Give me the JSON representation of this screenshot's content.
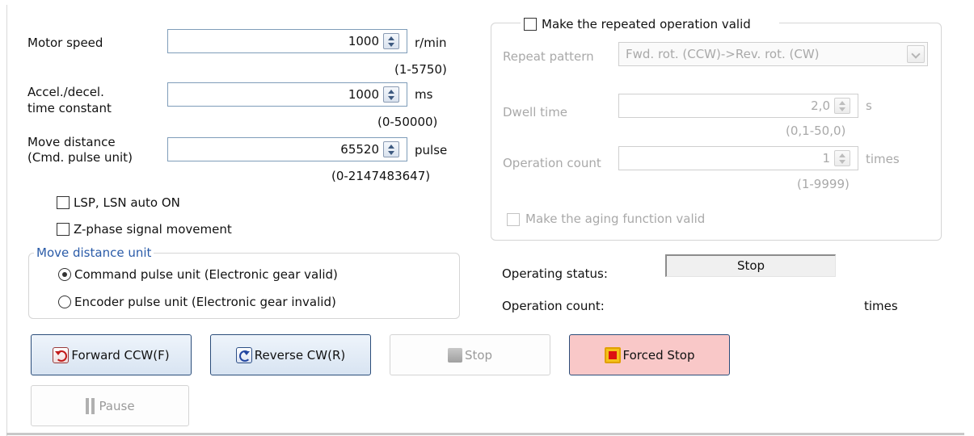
{
  "motor": {
    "speed_label": "Motor speed",
    "speed_value": "1000",
    "speed_unit": "r/min",
    "speed_range": "(1-5750)",
    "accel_label_line1": "Accel./decel.",
    "accel_label_line2": "time constant",
    "accel_value": "1000",
    "accel_unit": "ms",
    "accel_range": "(0-50000)",
    "distance_label_line1": "Move distance",
    "distance_label_line2": "(Cmd. pulse unit)",
    "distance_value": "65520",
    "distance_unit": "pulse",
    "distance_range": "(0-2147483647)"
  },
  "options": {
    "lsp_lsn_label": "LSP, LSN auto ON",
    "lsp_lsn_checked": false,
    "zphase_label": "Z-phase signal movement",
    "zphase_checked": false
  },
  "move_unit": {
    "legend": "Move distance unit",
    "options": [
      {
        "label": "Command pulse unit (Electronic gear valid)",
        "selected": true
      },
      {
        "label": "Encoder pulse unit (Electronic gear invalid)",
        "selected": false
      }
    ]
  },
  "repeat": {
    "enable_label": "Make the repeated operation valid",
    "enable_checked": false,
    "pattern_label": "Repeat pattern",
    "pattern_value": "Fwd. rot. (CCW)->Rev. rot. (CW)",
    "dwell_label": "Dwell time",
    "dwell_value": "2,0",
    "dwell_unit": "s",
    "dwell_range": "(0,1-50,0)",
    "count_label": "Operation count",
    "count_value": "1",
    "count_unit": "times",
    "count_range": "(1-9999)",
    "aging_label": "Make the aging function valid"
  },
  "status": {
    "operating_label": "Operating status:",
    "operating_value": "Stop",
    "count_label": "Operation count:",
    "count_unit": "times"
  },
  "buttons": {
    "forward": "Forward CCW(F)",
    "reverse": "Reverse CW(R)",
    "stop": "Stop",
    "forced_stop": "Forced Stop",
    "pause": "Pause"
  },
  "colors": {
    "forced_stop_bg": "#f9c8c8",
    "button_border": "#2b4d7a",
    "disabled_text": "#a9a9a9"
  }
}
